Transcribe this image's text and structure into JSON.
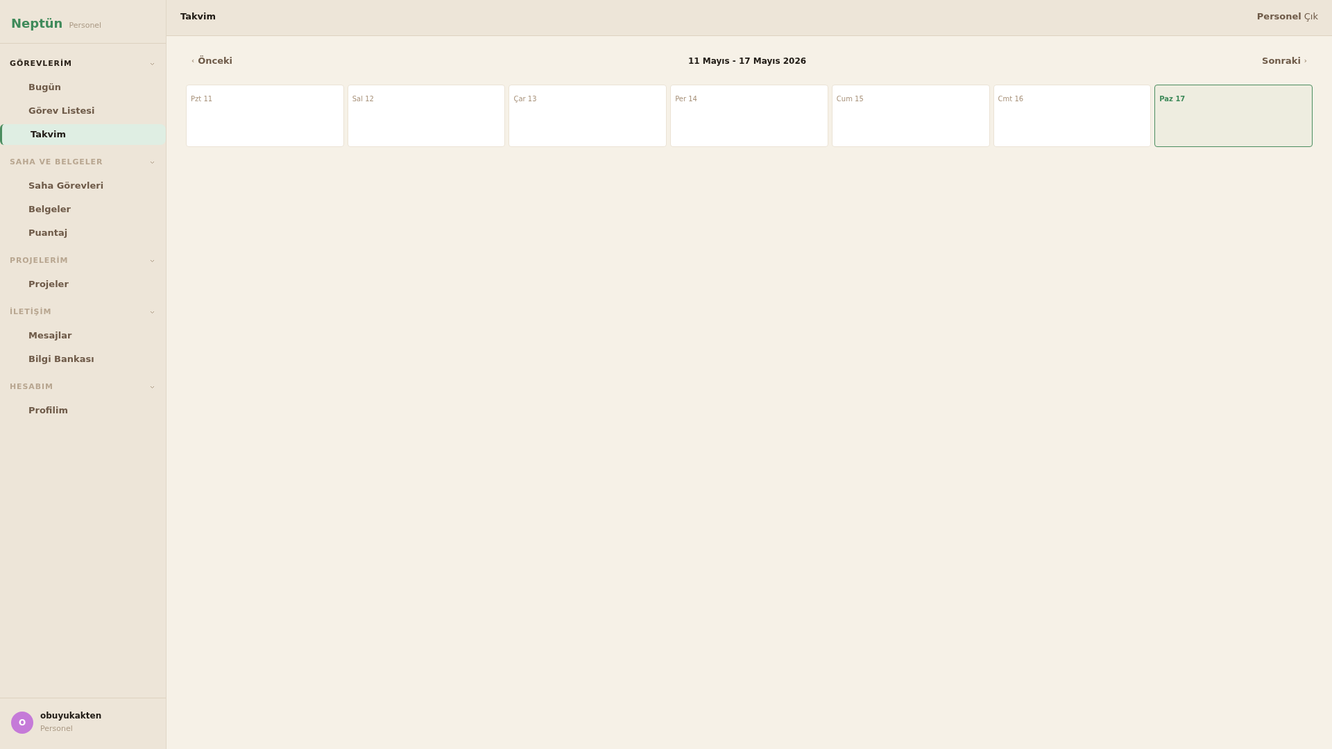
{
  "sidebar": {
    "brand": "Neptün",
    "brand_sub": "Personel",
    "sections": [
      {
        "title": "GÖREVLERİM",
        "expanded": true,
        "items": [
          {
            "label": "Bugün",
            "selected": false
          },
          {
            "label": "Görev Listesi",
            "selected": false
          },
          {
            "label": "Takvim",
            "selected": true
          }
        ]
      },
      {
        "title": "SAHA VE BELGELER",
        "expanded": true,
        "items": [
          {
            "label": "Saha Görevleri",
            "selected": false
          },
          {
            "label": "Belgeler",
            "selected": false
          },
          {
            "label": "Puantaj",
            "selected": false
          }
        ]
      },
      {
        "title": "PROJELERİM",
        "expanded": true,
        "items": [
          {
            "label": "Projeler",
            "selected": false
          }
        ]
      },
      {
        "title": "İLETİŞİM",
        "expanded": true,
        "items": [
          {
            "label": "Mesajlar",
            "selected": false
          },
          {
            "label": "Bilgi Bankası",
            "selected": false
          }
        ]
      },
      {
        "title": "HESABIM",
        "expanded": true,
        "items": [
          {
            "label": "Profilim",
            "selected": false
          }
        ]
      }
    ],
    "user": {
      "initial": "O",
      "name": "obuyukakten",
      "role": "Personel"
    }
  },
  "header": {
    "title": "Takvim",
    "role": "Personel",
    "logout": "Çık"
  },
  "calendar": {
    "prev": "Önceki",
    "prev_icon": "‹",
    "range": "11 Mayıs - 17 Mayıs 2026",
    "next": "Sonraki",
    "next_icon": "›",
    "days": [
      {
        "label": "Pzt 11",
        "selected": false
      },
      {
        "label": "Sal 12",
        "selected": false
      },
      {
        "label": "Çar 13",
        "selected": false
      },
      {
        "label": "Per 14",
        "selected": false
      },
      {
        "label": "Cum 15",
        "selected": false
      },
      {
        "label": "Cmt 16",
        "selected": false
      },
      {
        "label": "Paz 17",
        "selected": true
      }
    ]
  }
}
